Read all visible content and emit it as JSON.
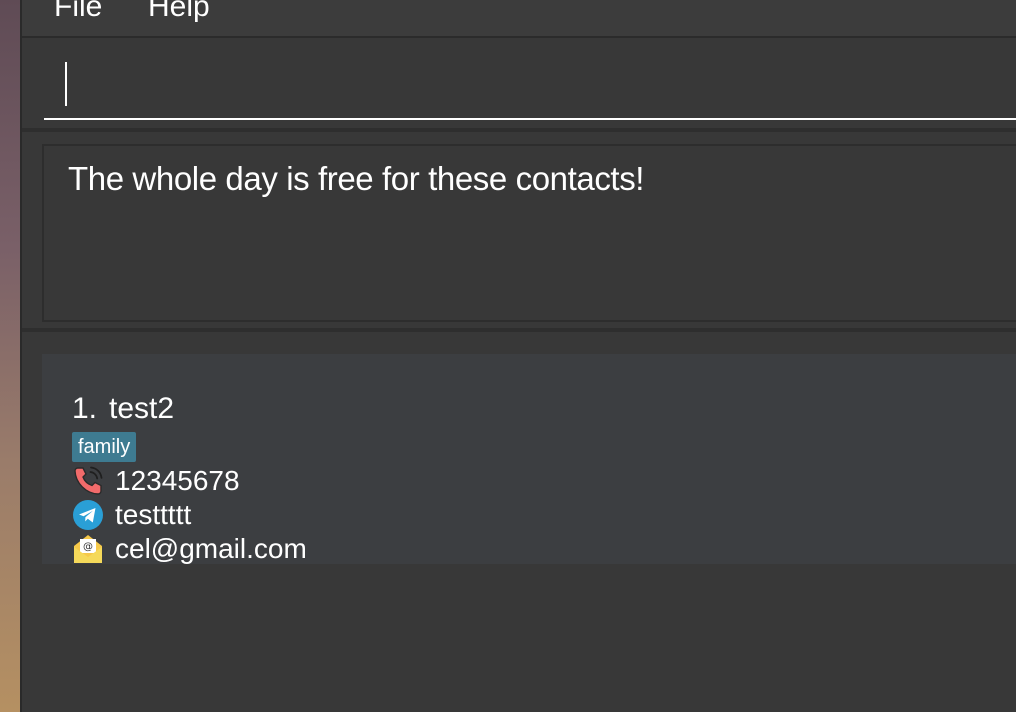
{
  "menu": {
    "items": [
      "File",
      "Help"
    ]
  },
  "command": {
    "value": ""
  },
  "result": {
    "message": "The whole day is free for these contacts!"
  },
  "contacts": [
    {
      "index": "1.",
      "name": "test2",
      "tag": "family",
      "phone": "12345678",
      "telegram": "testtttt",
      "email": "cel@gmail.com",
      "icons": {
        "phone": "phone-icon",
        "telegram": "telegram-icon",
        "email": "email-icon"
      }
    }
  ],
  "colors": {
    "background": "#383838",
    "card": "#3c3e41",
    "tag": "#3e7b91",
    "text": "#ffffff"
  }
}
